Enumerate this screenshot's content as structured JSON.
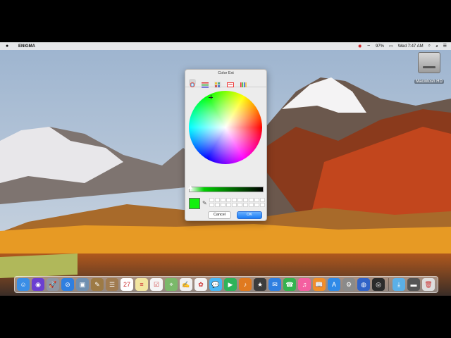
{
  "menubar": {
    "apple": "",
    "app_name": "ENIGMA",
    "battery": "97%",
    "clock": "Wed 7:47 AM"
  },
  "desktop": {
    "drive_label": "Macintosh HD"
  },
  "color_panel": {
    "title": "Color Ext",
    "tools": [
      "color-wheel",
      "color-sliders",
      "color-palettes",
      "image-palettes",
      "crayons"
    ],
    "selected_color": "#13f00f",
    "cancel_label": "Cancel",
    "ok_label": "OK"
  },
  "dock": {
    "apps": [
      {
        "name": "finder",
        "color": "#3a8ee6",
        "glyph": "☺"
      },
      {
        "name": "siri",
        "color": "#6b3fd1",
        "glyph": "◉"
      },
      {
        "name": "launchpad",
        "color": "#8f96a3",
        "glyph": "🚀"
      },
      {
        "name": "safari",
        "color": "#2f7fe0",
        "glyph": "⊘"
      },
      {
        "name": "photo-preview",
        "color": "#6f8fb0",
        "glyph": "▣"
      },
      {
        "name": "notes-brown",
        "color": "#9d7a45",
        "glyph": "✎"
      },
      {
        "name": "contacts",
        "color": "#a07b50",
        "glyph": "☰"
      },
      {
        "name": "calendar",
        "color": "#ffffff",
        "glyph": "27"
      },
      {
        "name": "notes",
        "color": "#f2e6a0",
        "glyph": "≡"
      },
      {
        "name": "reminders",
        "color": "#f5f5f5",
        "glyph": "☑"
      },
      {
        "name": "maps",
        "color": "#7ab96a",
        "glyph": "⌖"
      },
      {
        "name": "textedit",
        "color": "#f0f0f0",
        "glyph": "✍"
      },
      {
        "name": "photos",
        "color": "#f4f4f4",
        "glyph": "✿"
      },
      {
        "name": "messages",
        "color": "#48b7f5",
        "glyph": "💬"
      },
      {
        "name": "facetime",
        "color": "#2fb35a",
        "glyph": "▶"
      },
      {
        "name": "garageband",
        "color": "#e07a1f",
        "glyph": "♪"
      },
      {
        "name": "imovie",
        "color": "#3c3c3c",
        "glyph": "★"
      },
      {
        "name": "mail",
        "color": "#2f7fe0",
        "glyph": "✉"
      },
      {
        "name": "facetime-2",
        "color": "#34b34f",
        "glyph": "☎"
      },
      {
        "name": "itunes",
        "color": "#f45fa0",
        "glyph": "♫"
      },
      {
        "name": "ibooks",
        "color": "#f08f2a",
        "glyph": "📖"
      },
      {
        "name": "app-store",
        "color": "#2f8ae8",
        "glyph": "A"
      },
      {
        "name": "system-preferences",
        "color": "#8a8a8a",
        "glyph": "⚙"
      },
      {
        "name": "app-blue-circle",
        "color": "#3163c7",
        "glyph": "◍"
      },
      {
        "name": "obs",
        "color": "#2b2b2b",
        "glyph": "◎"
      },
      {
        "name": "downloads-folder",
        "color": "#5ab0e8",
        "glyph": "⤓"
      },
      {
        "name": "disk-drive",
        "color": "#555555",
        "glyph": "▬"
      },
      {
        "name": "trash",
        "color": "#dedede",
        "glyph": "🗑"
      }
    ]
  }
}
